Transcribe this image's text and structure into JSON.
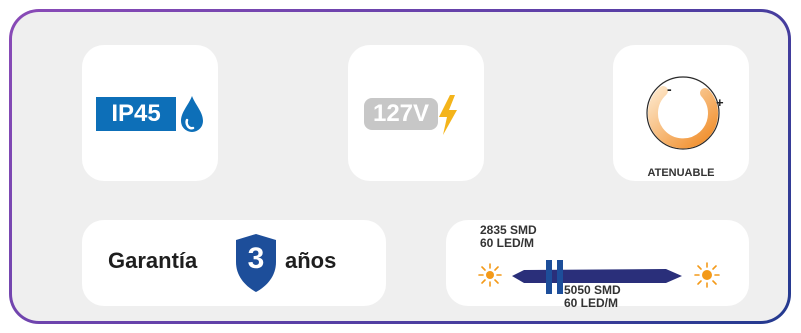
{
  "ip_card": {
    "badge_text": "IP45",
    "icon": "water-drop-icon",
    "accent": "#0d6fb8"
  },
  "voltage_card": {
    "badge_text": "127V",
    "icon": "lightning-bolt-icon",
    "accent": "#f4b41a"
  },
  "dimmable_card": {
    "label": "ATENUABLE",
    "minus": "-",
    "plus": "+",
    "icon": "dimmer-knob-icon",
    "accent": "#f08a24"
  },
  "warranty_card": {
    "prefix": "Garantía",
    "years": "3",
    "suffix": "años",
    "icon": "shield-icon",
    "accent": "#1d4e9a"
  },
  "led_card": {
    "top_line1": "2835 SMD",
    "top_line2": "60 LED/M",
    "bottom_line1": "5050 SMD",
    "bottom_line2": "60 LED/M",
    "icons": [
      "sun-icon",
      "sun-icon"
    ],
    "strip_color": "#2a2f7a",
    "sun_color": "#f39a1a"
  }
}
